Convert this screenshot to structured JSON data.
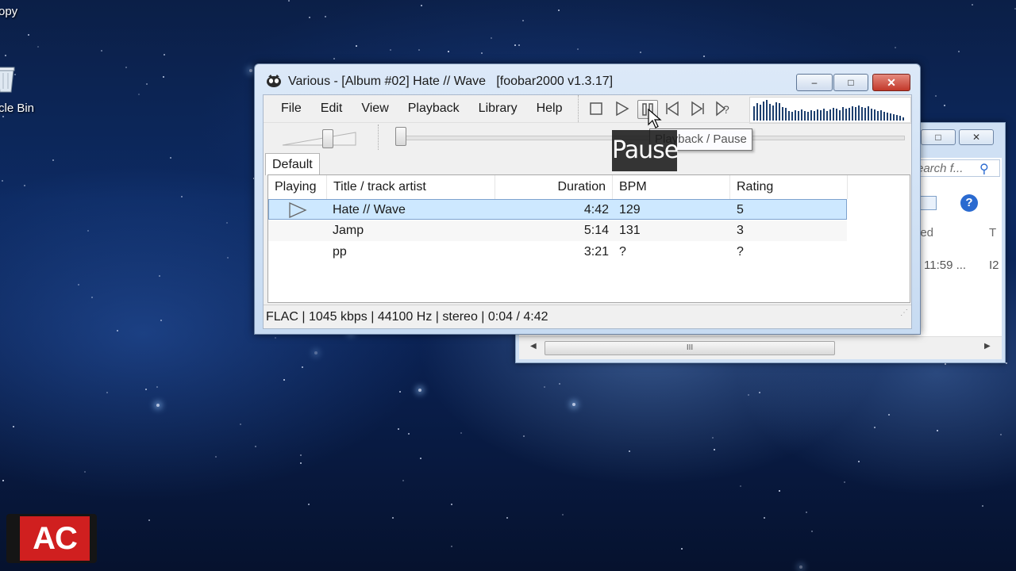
{
  "desktop": {
    "icon_top_label": "opy",
    "recycle_label": "cle Bin"
  },
  "foobar": {
    "title": "Various - [Album #02] Hate // Wave   [foobar2000 v1.3.17]",
    "menu": [
      "File",
      "Edit",
      "View",
      "Playback",
      "Library",
      "Help"
    ],
    "playlist_tab": "Default",
    "columns": {
      "playing": "Playing",
      "title": "Title / track artist",
      "duration": "Duration",
      "bpm": "BPM",
      "rating": "Rating"
    },
    "tracks": [
      {
        "title": "Hate // Wave",
        "duration": "4:42",
        "bpm": "129",
        "rating": "5"
      },
      {
        "title": "Jamp",
        "duration": "5:14",
        "bpm": "131",
        "rating": "3"
      },
      {
        "title": "pp",
        "duration": "3:21",
        "bpm": "?",
        "rating": "?"
      }
    ],
    "status": "FLAC | 1045 kbps | 44100 Hz | stereo | 0:04 / 4:42",
    "tooltip": "Playback / Pause",
    "selection_color": "#cde8ff"
  },
  "overlay": {
    "caption": "Pause",
    "logo": "AC",
    "logo_color": "#d01f1f"
  },
  "explorer": {
    "search_placeholder": "earch f...",
    "col_modified": "ied",
    "col_type": "T",
    "row_time": "11:59 ...",
    "row_type": "I2",
    "scroll_grip": "III"
  }
}
